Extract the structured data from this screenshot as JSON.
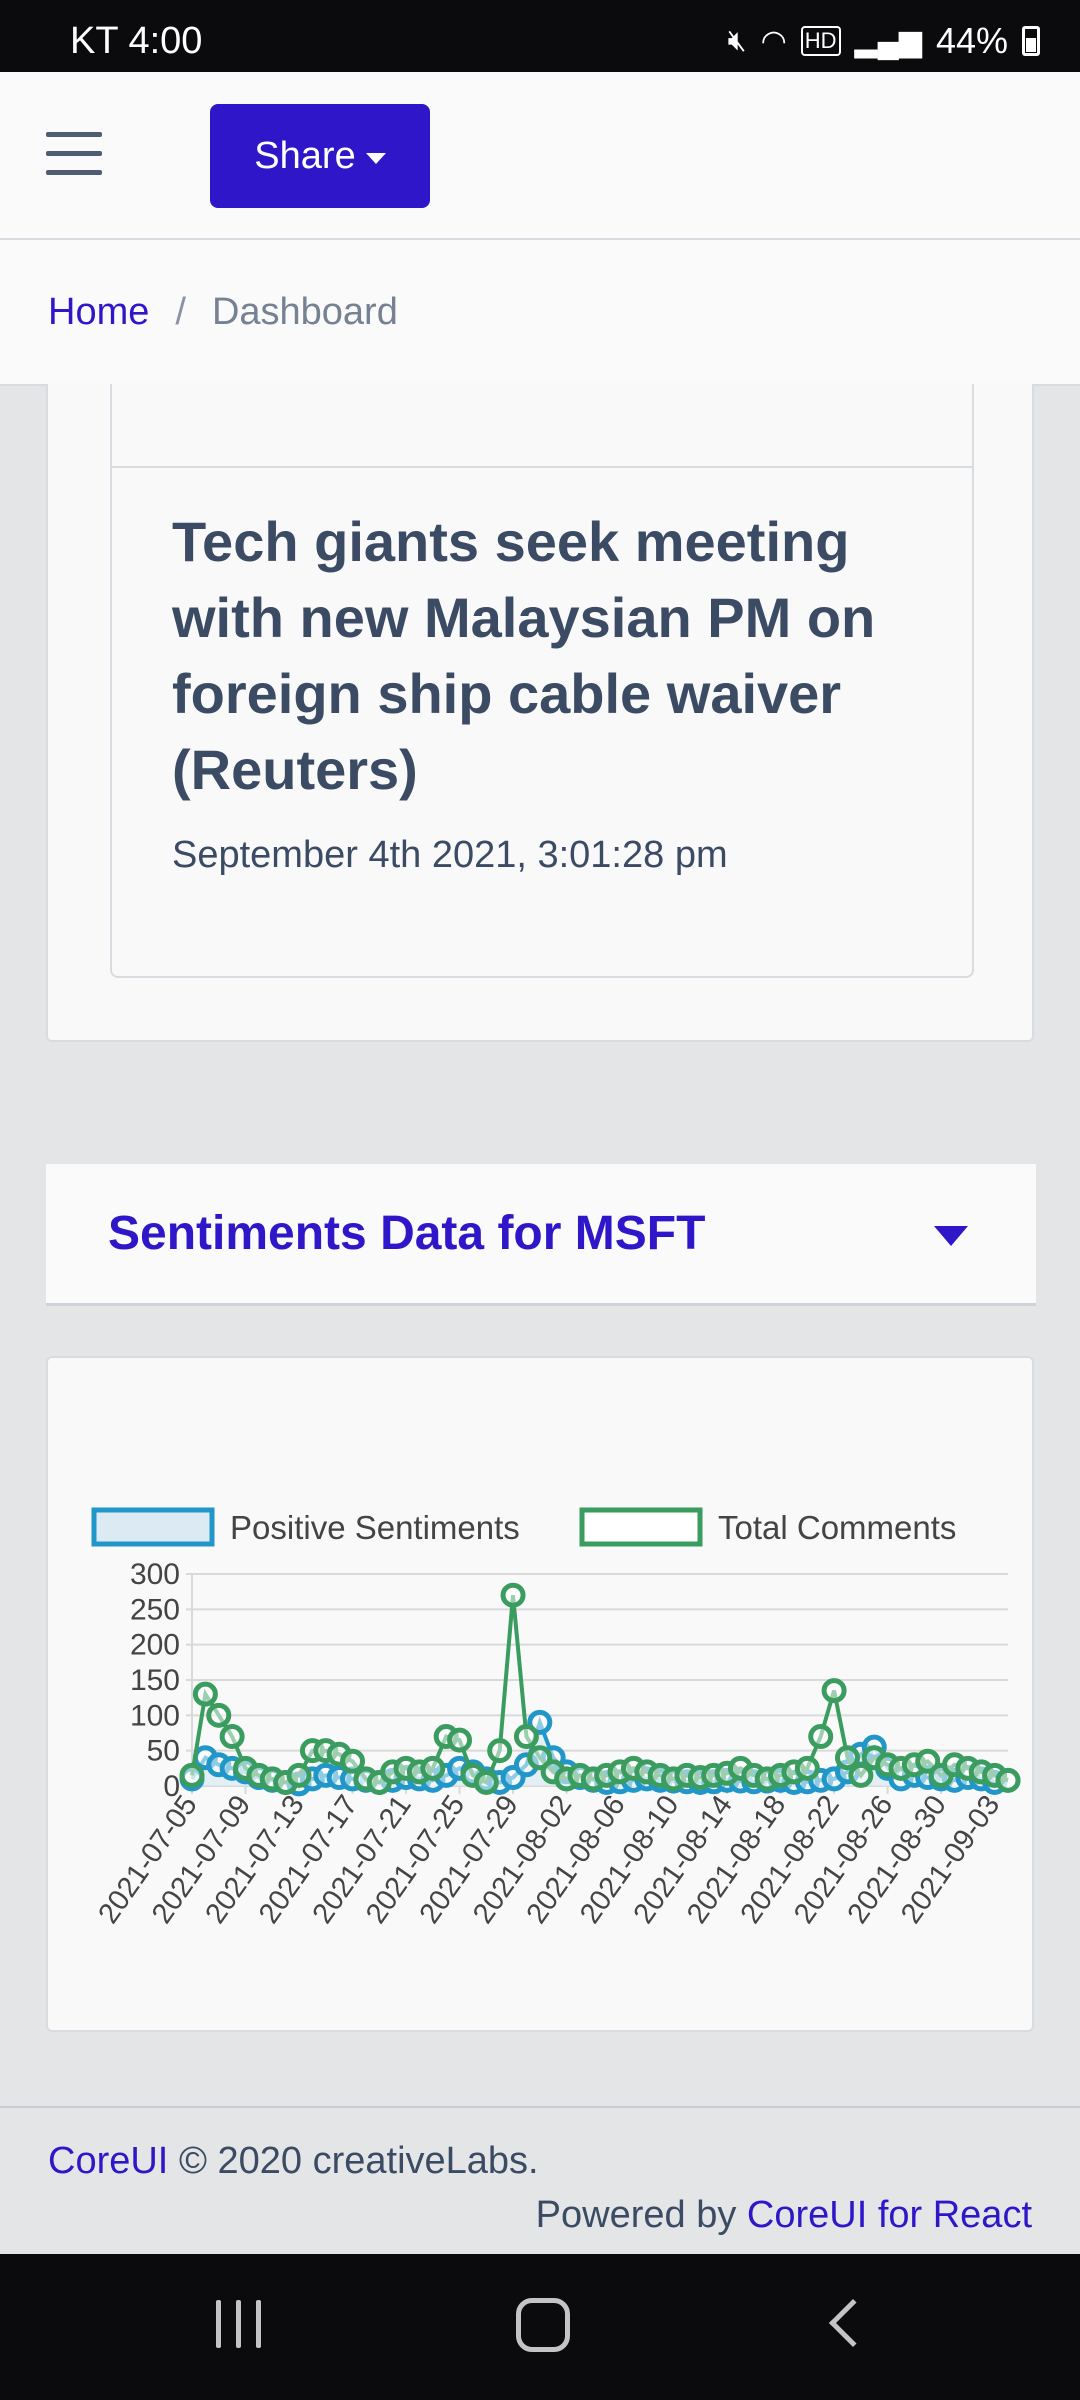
{
  "status_bar": {
    "carrier": "KT",
    "time": "4:00",
    "battery": "44%",
    "icons": [
      "mute-icon",
      "wifi-icon",
      "hd-icon",
      "signal-icon",
      "battery-icon"
    ]
  },
  "header": {
    "menu_icon": "hamburger-icon",
    "share_label": "Share"
  },
  "breadcrumb": {
    "home": "Home",
    "separator": "/",
    "current": "Dashboard"
  },
  "news": {
    "title": "Tech giants seek meeting with new Malaysian PM on foreign ship cable waiver (Reuters)",
    "date": "September 4th 2021, 3:01:28 pm"
  },
  "sentiment_section": {
    "title": "Sentiments Data for MSFT"
  },
  "chart_data": {
    "type": "line",
    "title": "",
    "xlabel": "",
    "ylabel": "",
    "ylim": [
      0,
      300
    ],
    "yticks": [
      0,
      50,
      100,
      150,
      200,
      250,
      300
    ],
    "grid": true,
    "legend_position": "top",
    "x_tick_labels": [
      "2021-07-05",
      "2021-07-09",
      "2021-07-13",
      "2021-07-17",
      "2021-07-21",
      "2021-07-25",
      "2021-07-29",
      "2021-08-02",
      "2021-08-06",
      "2021-08-10",
      "2021-08-14",
      "2021-08-18",
      "2021-08-22",
      "2021-08-26",
      "2021-08-30",
      "2021-09-03"
    ],
    "x_start": "2021-07-05",
    "x_end": "2021-09-04",
    "series": [
      {
        "name": "Positive Sentiments",
        "color": "#2196c8",
        "fill": "#dcebf3",
        "values": [
          10,
          40,
          30,
          25,
          20,
          12,
          8,
          5,
          3,
          10,
          15,
          12,
          10,
          8,
          5,
          8,
          12,
          10,
          8,
          15,
          25,
          20,
          10,
          5,
          12,
          30,
          90,
          40,
          20,
          12,
          8,
          5,
          6,
          8,
          10,
          8,
          7,
          6,
          5,
          6,
          8,
          7,
          6,
          7,
          8,
          5,
          6,
          8,
          10,
          20,
          45,
          55,
          25,
          10,
          15,
          12,
          10,
          8,
          12,
          10,
          5,
          8
        ]
      },
      {
        "name": "Total Comments",
        "color": "#3a9c5e",
        "values": [
          15,
          130,
          100,
          70,
          25,
          15,
          10,
          5,
          15,
          50,
          50,
          45,
          35,
          10,
          5,
          20,
          25,
          20,
          25,
          70,
          65,
          15,
          5,
          50,
          270,
          70,
          40,
          20,
          10,
          15,
          10,
          15,
          20,
          25,
          20,
          15,
          10,
          15,
          12,
          15,
          18,
          25,
          15,
          10,
          15,
          20,
          25,
          70,
          135,
          40,
          15,
          40,
          30,
          25,
          30,
          35,
          15,
          30,
          25,
          20,
          15,
          8
        ]
      }
    ]
  },
  "footer": {
    "brand_link": "CoreUI",
    "copyright": "© 2020 creativeLabs.",
    "powered_by": "Powered by",
    "powered_link": "CoreUI for React"
  },
  "nav_bar": {
    "icons": [
      "recents-icon",
      "home-icon",
      "back-icon"
    ]
  }
}
